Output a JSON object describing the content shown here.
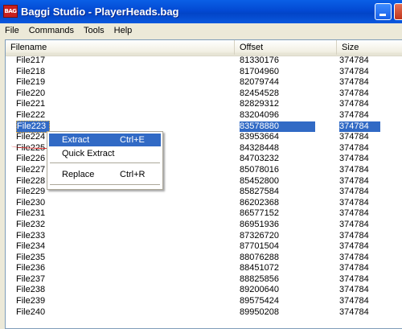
{
  "window": {
    "title": "Baggi Studio - PlayerHeads.bag",
    "icon_text": "BAG"
  },
  "menubar": {
    "items": [
      "File",
      "Commands",
      "Tools",
      "Help"
    ]
  },
  "list": {
    "columns": [
      "Filename",
      "Offset",
      "Size"
    ],
    "rows": [
      {
        "name": "File217",
        "offset": "81330176",
        "size": "374784"
      },
      {
        "name": "File218",
        "offset": "81704960",
        "size": "374784"
      },
      {
        "name": "File219",
        "offset": "82079744",
        "size": "374784"
      },
      {
        "name": "File220",
        "offset": "82454528",
        "size": "374784"
      },
      {
        "name": "File221",
        "offset": "82829312",
        "size": "374784"
      },
      {
        "name": "File222",
        "offset": "83204096",
        "size": "374784"
      },
      {
        "name": "File223",
        "offset": "83578880",
        "size": "374784",
        "selected": true
      },
      {
        "name": "File224",
        "offset": "83953664",
        "size": "374784"
      },
      {
        "name": "File225",
        "offset": "84328448",
        "size": "374784"
      },
      {
        "name": "File226",
        "offset": "84703232",
        "size": "374784"
      },
      {
        "name": "File227",
        "offset": "85078016",
        "size": "374784"
      },
      {
        "name": "File228",
        "offset": "85452800",
        "size": "374784"
      },
      {
        "name": "File229",
        "offset": "85827584",
        "size": "374784"
      },
      {
        "name": "File230",
        "offset": "86202368",
        "size": "374784"
      },
      {
        "name": "File231",
        "offset": "86577152",
        "size": "374784"
      },
      {
        "name": "File232",
        "offset": "86951936",
        "size": "374784"
      },
      {
        "name": "File233",
        "offset": "87326720",
        "size": "374784"
      },
      {
        "name": "File234",
        "offset": "87701504",
        "size": "374784"
      },
      {
        "name": "File235",
        "offset": "88076288",
        "size": "374784"
      },
      {
        "name": "File236",
        "offset": "88451072",
        "size": "374784"
      },
      {
        "name": "File237",
        "offset": "88825856",
        "size": "374784"
      },
      {
        "name": "File238",
        "offset": "89200640",
        "size": "374784"
      },
      {
        "name": "File239",
        "offset": "89575424",
        "size": "374784"
      },
      {
        "name": "File240",
        "offset": "89950208",
        "size": "374784"
      }
    ]
  },
  "context_menu": {
    "items": [
      {
        "label": "Extract",
        "shortcut": "Ctrl+E",
        "active": true
      },
      {
        "label": "Quick Extract",
        "shortcut": ""
      },
      {
        "label": "Replace",
        "shortcut": "Ctrl+R"
      }
    ]
  },
  "colors": {
    "titlebar": "#0A5FE6",
    "selection": "#316AC5",
    "window_bg": "#ECE9D8"
  }
}
